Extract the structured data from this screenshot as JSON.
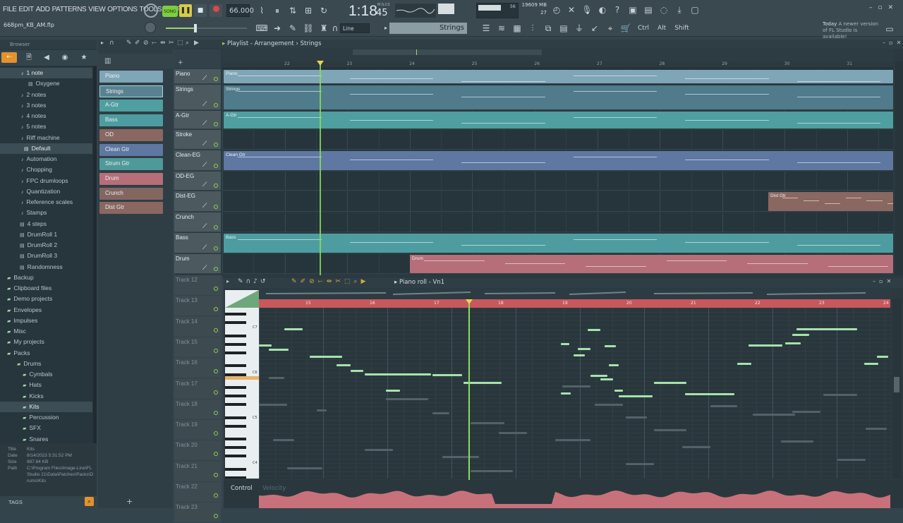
{
  "menu": [
    "FILE",
    "EDIT",
    "ADD",
    "PATTERNS",
    "VIEW",
    "OPTIONS",
    "TOOLS",
    "HELP"
  ],
  "project_file": "668pm_KB_AM.flp",
  "transport": {
    "song_label": "SONG",
    "tempo": "66.000",
    "time_main": "1:18",
    "time_sub": "45",
    "time_unit": "M:S:CS",
    "cpu_value": "56",
    "mem_value": "19609 MB",
    "voices": "27",
    "snap": "Line",
    "pattern_name": "Strings",
    "mods": [
      "Ctrl",
      "Alt",
      "Shift"
    ]
  },
  "notification": {
    "today": "Today",
    "text": "A newer version of FL Studio is available!"
  },
  "browser": {
    "title": "Browser",
    "items": [
      {
        "label": "1 note",
        "kind": "note",
        "hl": true
      },
      {
        "label": "Oxygene",
        "kind": "file"
      },
      {
        "label": "2 notes",
        "kind": "note"
      },
      {
        "label": "3 notes",
        "kind": "note"
      },
      {
        "label": "4 notes",
        "kind": "note"
      },
      {
        "label": "5 notes",
        "kind": "note"
      },
      {
        "label": "Riff machine",
        "kind": "note"
      },
      {
        "label": "Default",
        "kind": "file",
        "hl": true
      },
      {
        "label": "Automation",
        "kind": "note"
      },
      {
        "label": "Chopping",
        "kind": "note"
      },
      {
        "label": "FPC drumloops",
        "kind": "note"
      },
      {
        "label": "Quantization",
        "kind": "note"
      },
      {
        "label": "Reference scales",
        "kind": "note"
      },
      {
        "label": "Stamps",
        "kind": "note"
      },
      {
        "label": "4 steps",
        "kind": "file"
      },
      {
        "label": "DrumRoll 1",
        "kind": "file"
      },
      {
        "label": "DrumRoll 2",
        "kind": "file"
      },
      {
        "label": "DrumRoll 3",
        "kind": "file"
      },
      {
        "label": "Randomness",
        "kind": "file"
      },
      {
        "label": "Backup",
        "kind": "folder"
      },
      {
        "label": "Clipboard files",
        "kind": "folder"
      },
      {
        "label": "Demo projects",
        "kind": "folder"
      },
      {
        "label": "Envelopes",
        "kind": "folder"
      },
      {
        "label": "Impulses",
        "kind": "folder"
      },
      {
        "label": "Misc",
        "kind": "folder"
      },
      {
        "label": "My projects",
        "kind": "folder"
      },
      {
        "label": "Packs",
        "kind": "folder"
      },
      {
        "label": "Drums",
        "kind": "folder"
      },
      {
        "label": "Cymbals",
        "kind": "folder"
      },
      {
        "label": "Hats",
        "kind": "folder"
      },
      {
        "label": "Kicks",
        "kind": "folder"
      },
      {
        "label": "Kits",
        "kind": "folder",
        "hl": true
      },
      {
        "label": "Percussion",
        "kind": "folder"
      },
      {
        "label": "SFX",
        "kind": "folder"
      },
      {
        "label": "Snares",
        "kind": "folder"
      },
      {
        "label": "Toms",
        "kind": "folder"
      }
    ],
    "info": {
      "title_k": "Title",
      "title_v": "Kits",
      "date_k": "Date",
      "date_v": "8/14/2023 5:31:52 PM",
      "size_k": "Size",
      "size_v": "987.84 KB",
      "path_k": "Path",
      "path_v": "C:\\Program Files\\Image-Line\\FL Studio 21\\Data\\Patches\\Packs\\Drums\\Kits"
    },
    "tags_label": "TAGS"
  },
  "channels": [
    {
      "label": "Piano",
      "color": "#7fa6b7"
    },
    {
      "label": "Strings",
      "color": "#5a8190"
    },
    {
      "label": "A-Gtr",
      "color": "#4f9ea0"
    },
    {
      "label": "Bass",
      "color": "#4d9da0"
    },
    {
      "label": "OD",
      "color": "#8a6760"
    },
    {
      "label": "Clean Gtr",
      "color": "#5e78a2"
    },
    {
      "label": "Strum Gtr",
      "color": "#4f999a"
    },
    {
      "label": "Drum",
      "color": "#b66e79"
    },
    {
      "label": "Crunch",
      "color": "#846660"
    },
    {
      "label": "Dist Gtr",
      "color": "#8a6760"
    }
  ],
  "playlist": {
    "title": "Playlist - Arrangement",
    "pattern": "Strings",
    "bars": [
      "22",
      "23",
      "24",
      "25",
      "26",
      "27",
      "28",
      "29",
      "30",
      "31"
    ],
    "tracks": [
      {
        "label": "Piano"
      },
      {
        "label": "Strings"
      },
      {
        "label": "A-Gtr"
      },
      {
        "label": "Stroke"
      },
      {
        "label": "Clean-EG"
      },
      {
        "label": "OD-EG"
      },
      {
        "label": "Dist-EG"
      },
      {
        "label": "Crunch"
      },
      {
        "label": "Bass"
      },
      {
        "label": "Drum"
      }
    ],
    "clips": [
      "Piano",
      "Strings",
      "A-Gtr",
      "Clean Gtr",
      "Dist Gtr",
      "Bass",
      "Drum"
    ],
    "empty_tracks": [
      "Track 12",
      "Track 13",
      "Track 14",
      "Track 15",
      "Track 16",
      "Track 17",
      "Track 18",
      "Track 19",
      "Track 20",
      "Track 21",
      "Track 22",
      "Track 23"
    ]
  },
  "piano_roll": {
    "title": "Piano roll - Vn1",
    "bars": [
      "15",
      "16",
      "17",
      "18",
      "19",
      "20",
      "21",
      "22",
      "23",
      "24"
    ],
    "octaves": [
      "C7",
      "C6",
      "C5",
      "C4"
    ],
    "control_label": "Control",
    "control_sub": "Velocity"
  }
}
